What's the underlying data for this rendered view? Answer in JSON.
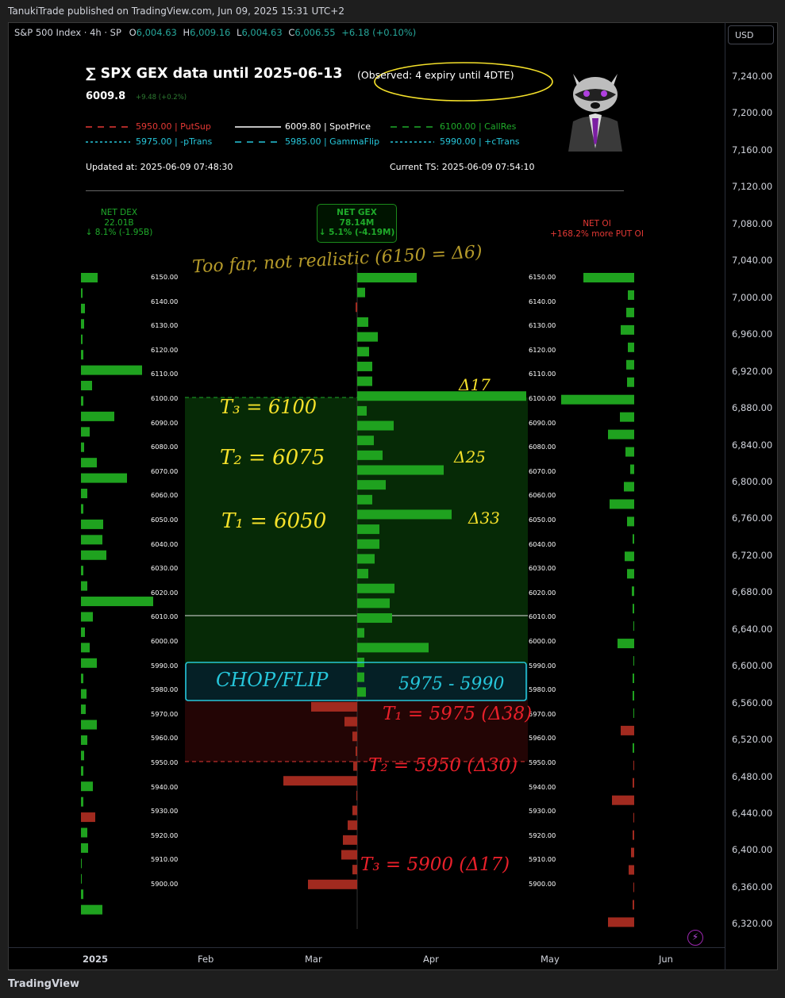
{
  "header": {
    "publisher_line": "TanukiTrade published on TradingView.com, Jun 09, 2025 15:31 UTC+2"
  },
  "symbol_bar": {
    "name": "S&P 500 Index · 4h · SP",
    "o_label": "O",
    "o": "6,004.63",
    "h_label": "H",
    "h": "6,009.16",
    "l_label": "L",
    "l": "6,004.63",
    "c_label": "C",
    "c": "6,006.55",
    "chg": "+6.18 (+0.10%)"
  },
  "currency": "USD",
  "price_axis": [
    "7,240.00",
    "7,200.00",
    "7,160.00",
    "7,120.00",
    "7,080.00",
    "7,040.00",
    "7,000.00",
    "6,960.00",
    "6,920.00",
    "6,880.00",
    "6,840.00",
    "6,800.00",
    "6,760.00",
    "6,720.00",
    "6,680.00",
    "6,640.00",
    "6,600.00",
    "6,560.00",
    "6,520.00",
    "6,480.00",
    "6,440.00",
    "6,400.00",
    "6,360.00",
    "6,320.00"
  ],
  "time_axis": [
    "2025",
    "Feb",
    "Mar",
    "Apr",
    "May",
    "Jun"
  ],
  "footer": {
    "brand": "TradingView"
  },
  "gex": {
    "title": "∑ SPX GEX data until 2025-06-13",
    "spot": "6009.8",
    "spot_change": "+9.48 (+0.2%)",
    "observed": "(Observed: 4 expiry until 4DTE)",
    "legend": [
      {
        "label": "5950.00 | PutSup",
        "color": "#e53935",
        "style": "dashed"
      },
      {
        "label": "6009.80 | SpotPrice",
        "color": "#ffffff",
        "style": "solid"
      },
      {
        "label": "6100.00 | CallRes",
        "color": "#1faa2a",
        "style": "dashed"
      },
      {
        "label": "5975.00 | -pTrans",
        "color": "#26c6da",
        "style": "dotted"
      },
      {
        "label": "5985.00 | GammaFlip",
        "color": "#26c6da",
        "style": "dashed"
      },
      {
        "label": "5990.00 | +cTrans",
        "color": "#26c6da",
        "style": "dotted"
      }
    ],
    "updated": "Updated at: 2025-06-09 07:48:30",
    "current_ts": "Current TS: 2025-06-09 07:54:10",
    "net_dex": {
      "title": "NET DEX",
      "value": "22.01B",
      "change": "↓ 8.1% (-1.95B)"
    },
    "net_gex": {
      "title": "NET GEX",
      "value": "78.14M",
      "change": "↓ 5.1% (-4.19M)"
    },
    "net_oi": {
      "title": "NET OI",
      "value": "+168.2% more PUT OI"
    },
    "strikes": [
      "6150.00",
      "6140.00",
      "6130.00",
      "6120.00",
      "6110.00",
      "6100.00",
      "6090.00",
      "6080.00",
      "6070.00",
      "6060.00",
      "6050.00",
      "6040.00",
      "6030.00",
      "6020.00",
      "6010.00",
      "6000.00",
      "5990.00",
      "5980.00",
      "5970.00",
      "5960.00",
      "5950.00",
      "5940.00",
      "5930.00",
      "5920.00",
      "5910.00",
      "5900.00"
    ],
    "dex_bars": [
      21,
      2,
      5,
      4,
      2,
      3,
      77,
      14,
      3,
      42,
      11,
      4,
      20,
      58,
      8,
      3,
      28,
      27,
      32,
      3,
      8,
      91,
      15,
      5,
      11,
      20,
      3,
      7,
      6,
      20,
      8,
      4,
      3,
      15,
      3,
      18,
      8,
      9,
      1,
      1,
      3,
      27
    ],
    "gex_bars": [
      75,
      10,
      -2,
      14,
      26,
      15,
      19,
      19,
      213,
      12,
      46,
      21,
      32,
      109,
      36,
      19,
      119,
      28,
      28,
      22,
      14,
      47,
      41,
      44,
      9,
      90,
      9,
      9,
      11,
      -58,
      -16,
      -6,
      -2,
      -5,
      -93,
      -1,
      -6,
      -12,
      -18,
      -20,
      -6,
      -62
    ],
    "oi_bars": [
      64,
      8,
      10,
      17,
      8,
      10,
      9,
      92,
      18,
      33,
      11,
      5,
      13,
      31,
      9,
      2,
      12,
      9,
      3,
      2,
      1,
      21,
      1,
      2,
      2,
      1,
      -17,
      2,
      -1,
      -2,
      -28,
      -1,
      -2,
      -4,
      -7,
      -1,
      -2,
      -33
    ],
    "annotations": {
      "observed_circle": "",
      "too_far": "Too far, not realistic (6150 = Δ6)",
      "t3_up": "T₃ = 6100",
      "t2_up": "T₂ = 6075",
      "t1_up": "T₁ = 6050",
      "d17": "Δ17",
      "d25": "Δ25",
      "d33": "Δ33",
      "chop": "CHOP/FLIP",
      "range": "5975 - 5990",
      "t1_dn": "T₁ = 5975 (Δ38)",
      "t2_dn": "T₂ = 5950 (Δ30)",
      "t3_dn": "T₃ = 5900 (Δ17)"
    }
  },
  "colors": {
    "green": "#1fa21f",
    "red": "#a12a1f",
    "cyan": "#26c6da",
    "yellow": "#f5e12a",
    "pen_red": "#e8202a"
  }
}
